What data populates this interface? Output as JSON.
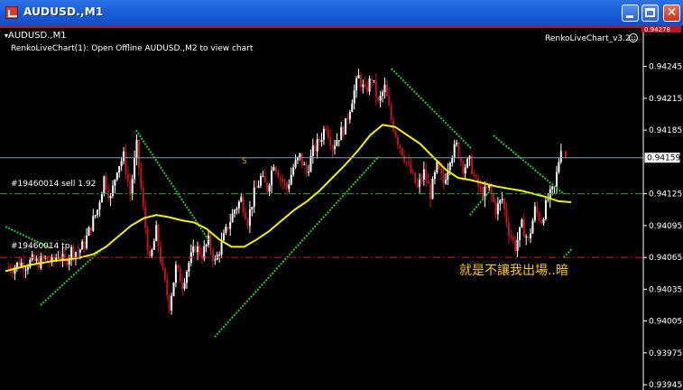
{
  "window": {
    "title": "AUDUSD.,M1"
  },
  "chart": {
    "symbol_label": "AUDUSD.,M1",
    "indicator_message": "RenkoLiveChart(1): Open Offline AUDUSD.,M2 to view chart",
    "indicator_name": "RenkoLiveChart_v3.2",
    "top_price_label": "0.94278",
    "order_sell_label": "#19460014 sell 1.92",
    "order_tp_label": "#19460014 tp",
    "annotation": "就是不讓我出場..暗",
    "marker_label": "S",
    "current_price": "0.94159",
    "colors": {
      "background": "#000000",
      "bull_candle": "#ffffff",
      "bear_candle": "#c0141c",
      "ma_line": "#f2f200",
      "trail_line": "#22cc22",
      "sell_line": "#22aa22",
      "tp_line": "#cc2222",
      "price_line": "#8899aa",
      "annotation": "#ffc800"
    }
  },
  "chart_data": {
    "type": "candlestick",
    "symbol": "AUDUSD.",
    "timeframe": "M1",
    "y_ticks": [
      0.94245,
      0.94215,
      0.94185,
      0.94159,
      0.94125,
      0.94095,
      0.94065,
      0.94035,
      0.94005,
      0.93975,
      0.93945
    ],
    "ylim": [
      0.9394,
      0.94283
    ],
    "close_profile": [
      0.94056,
      0.94055,
      0.9406,
      0.94058,
      0.94062,
      0.9406,
      0.94064,
      0.9406,
      0.94068,
      0.9406,
      0.94072,
      0.9407,
      0.94078,
      0.94095,
      0.9411,
      0.9414,
      0.9412,
      0.9415,
      0.9416,
      0.94125,
      0.9417,
      0.9411,
      0.9406,
      0.9409,
      0.9405,
      0.9402,
      0.94055,
      0.9404,
      0.9406,
      0.94075,
      0.94068,
      0.9408,
      0.9406,
      0.94078,
      0.94095,
      0.9411,
      0.9412,
      0.941,
      0.94125,
      0.9414,
      0.9413,
      0.94155,
      0.9414,
      0.9413,
      0.9415,
      0.9416,
      0.94145,
      0.94165,
      0.94175,
      0.9419,
      0.9417,
      0.9418,
      0.9419,
      0.94215,
      0.94235,
      0.9422,
      0.94235,
      0.9421,
      0.94225,
      0.94195,
      0.94175,
      0.9416,
      0.94145,
      0.9413,
      0.94145,
      0.94125,
      0.9415,
      0.94135,
      0.9416,
      0.9417,
      0.9415,
      0.94155,
      0.94135,
      0.94125,
      0.9413,
      0.9411,
      0.9412,
      0.9409,
      0.94075,
      0.94095,
      0.9408,
      0.9411,
      0.941,
      0.9412,
      0.9413,
      0.9417
    ],
    "ma_profile": [
      0.94052,
      0.94055,
      0.94058,
      0.9406,
      0.94062,
      0.94063,
      0.94065,
      0.94068,
      0.94075,
      0.94085,
      0.94095,
      0.94102,
      0.94105,
      0.94103,
      0.941,
      0.94098,
      0.94092,
      0.94082,
      0.94075,
      0.94075,
      0.94082,
      0.9409,
      0.941,
      0.9411,
      0.94118,
      0.94128,
      0.9414,
      0.94152,
      0.94165,
      0.9418,
      0.9419,
      0.94188,
      0.9418,
      0.94172,
      0.9416,
      0.94148,
      0.9414,
      0.94138,
      0.94135,
      0.94132,
      0.9413,
      0.94128,
      0.94125,
      0.94122,
      0.94118,
      0.94117
    ],
    "sell_level": 0.94125,
    "tp_level": 0.94065
  }
}
